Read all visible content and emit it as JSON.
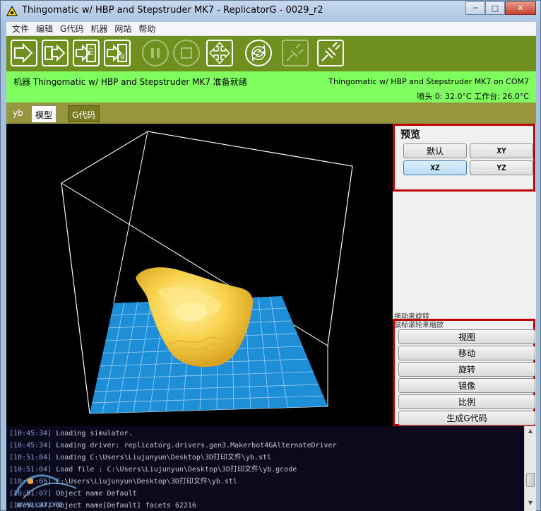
{
  "window": {
    "title": "Thingomatic w/ HBP and Stepstruder MK7 - ReplicatorG - 0029_r2",
    "controls": {
      "minimize": "─",
      "maximize": "□",
      "close": "✕"
    }
  },
  "menu": [
    "文件",
    "编辑",
    "G代码",
    "机器",
    "网站",
    "帮助"
  ],
  "toolbar": {
    "icons": [
      "build-icon",
      "upload-icon",
      "build-to-file-icon",
      "upload-file-icon",
      "pause-icon",
      "stop-icon",
      "control-panel-icon",
      "reset-icon",
      "disconnect-icon",
      "connect-icon"
    ]
  },
  "status": {
    "main": "机器 Thingomatic w/ HBP and Stepstruder MK7 准备就绪",
    "machine": "Thingomatic w/ HBP and Stepstruder MK7 on COM7",
    "temps": "喷头 0: 32.0°C  工作台: 26.0°C"
  },
  "tabs": [
    "yb",
    "模型",
    "G代码"
  ],
  "preview": {
    "title": "预览",
    "buttons": [
      "默认",
      "XY",
      "XZ",
      "YZ"
    ],
    "selected": "XZ"
  },
  "hints": [
    "拖动来旋转",
    "鼠标滚轮来缩放"
  ],
  "actions": [
    "视图",
    "移动",
    "旋转",
    "镜像",
    "比例",
    "生成G代码"
  ],
  "console": [
    {
      "ts": "[10:45:34]",
      "msg": " Loading simulator."
    },
    {
      "ts": "[10:45:34]",
      "msg": " Loading driver: replicatorg.drivers.gen3.Makerbot4GAlternateDriver"
    },
    {
      "ts": "[10:51:04]",
      "msg": " Loading C:\\Users\\Liujunyun\\Desktop\\3D打印文件\\yb.stl"
    },
    {
      "ts": "[10:51:04]",
      "msg": " Load file : C:\\Users\\Liujunyun\\Desktop\\3D打印文件\\yb.gcode"
    },
    {
      "ts": "[10:51:05]",
      "msg": " C:\\Users\\Liujunyun\\Desktop\\3D打印文件\\yb.stl"
    },
    {
      "ts": "[10:51:07]",
      "msg": " Object name Default"
    },
    {
      "ts": "[10:51:07]",
      "msg": " Object name[Default] facets 62216"
    }
  ],
  "watermark": "WWW.ICAX.ORG",
  "colors": {
    "toolbar": "#6f8f1f",
    "status": "#80ff60",
    "tabstrip": "#97963f",
    "highlight_border": "#c00000",
    "bed": "#1e8fd6",
    "model": "#f5c842"
  }
}
